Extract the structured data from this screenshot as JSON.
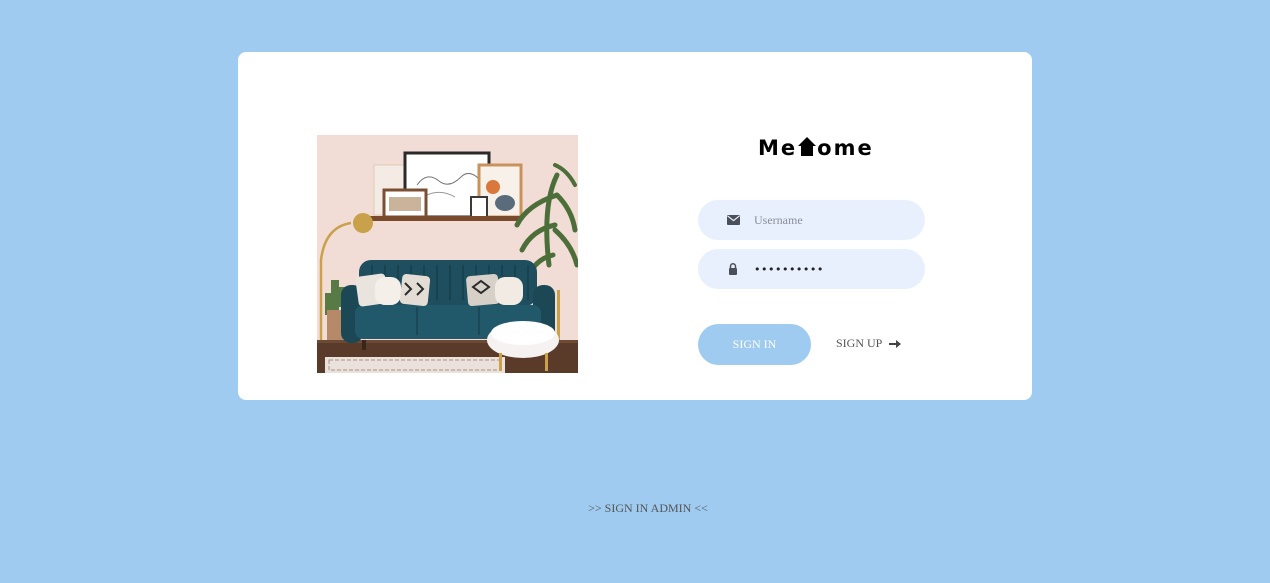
{
  "brand": {
    "logo_left": "Me",
    "logo_icon": "house-icon",
    "logo_right": "ome"
  },
  "form": {
    "username_placeholder": "Username",
    "username_icon": "envelope-icon",
    "password_value": "••••••••••",
    "password_icon": "lock-icon",
    "signin_label": "SIGN IN",
    "signup_label": "SIGN UP",
    "signup_icon": "arrow-right-icon"
  },
  "footer": {
    "admin_link": ">> SIGN IN ADMIN <<"
  },
  "colors": {
    "background": "#9fcbf0",
    "card": "#ffffff",
    "field": "#e8f0fe",
    "button": "#9fcbf0"
  }
}
